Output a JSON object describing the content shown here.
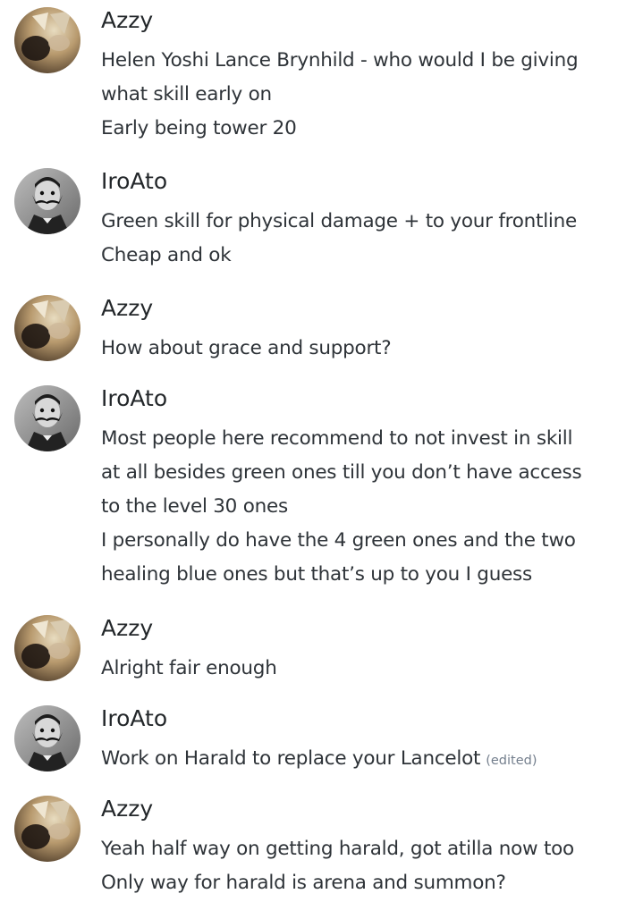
{
  "messages": [
    {
      "author": "Azzy",
      "avatar": "dog-avatar",
      "lines": [
        "Helen Yoshi Lance Brynhild - who would I be giving",
        "what skill early on",
        "Early being tower 20"
      ]
    },
    {
      "author": "IroAto",
      "avatar": "mustache-man-avatar",
      "lines": [
        "Green skill for physical damage + to your frontline",
        "Cheap and ok"
      ]
    },
    {
      "author": "Azzy",
      "avatar": "dog-avatar",
      "lines": [
        "How about grace and support?"
      ]
    },
    {
      "author": "IroAto",
      "avatar": "mustache-man-avatar",
      "lines": [
        "Most people here recommend to not invest in skill",
        "at all besides green ones till you don’t have access",
        "to the level 30 ones",
        "I personally do have the 4 green ones and the two",
        "healing blue ones but that’s up to you I guess"
      ]
    },
    {
      "author": "Azzy",
      "avatar": "dog-avatar",
      "lines": [
        "Alright fair enough"
      ]
    },
    {
      "author": "IroAto",
      "avatar": "mustache-man-avatar",
      "lines": [
        "Work on Harald to replace your Lancelot"
      ],
      "edited_label": "(edited)"
    },
    {
      "author": "Azzy",
      "avatar": "dog-avatar",
      "lines": [
        "Yeah half way on getting harald, got atilla now too",
        "Only way for harald is arena and summon?"
      ]
    }
  ],
  "colors": {
    "background": "#ffffff",
    "author": "#23272a",
    "text": "#2e3338",
    "edited": "#747f8d"
  }
}
